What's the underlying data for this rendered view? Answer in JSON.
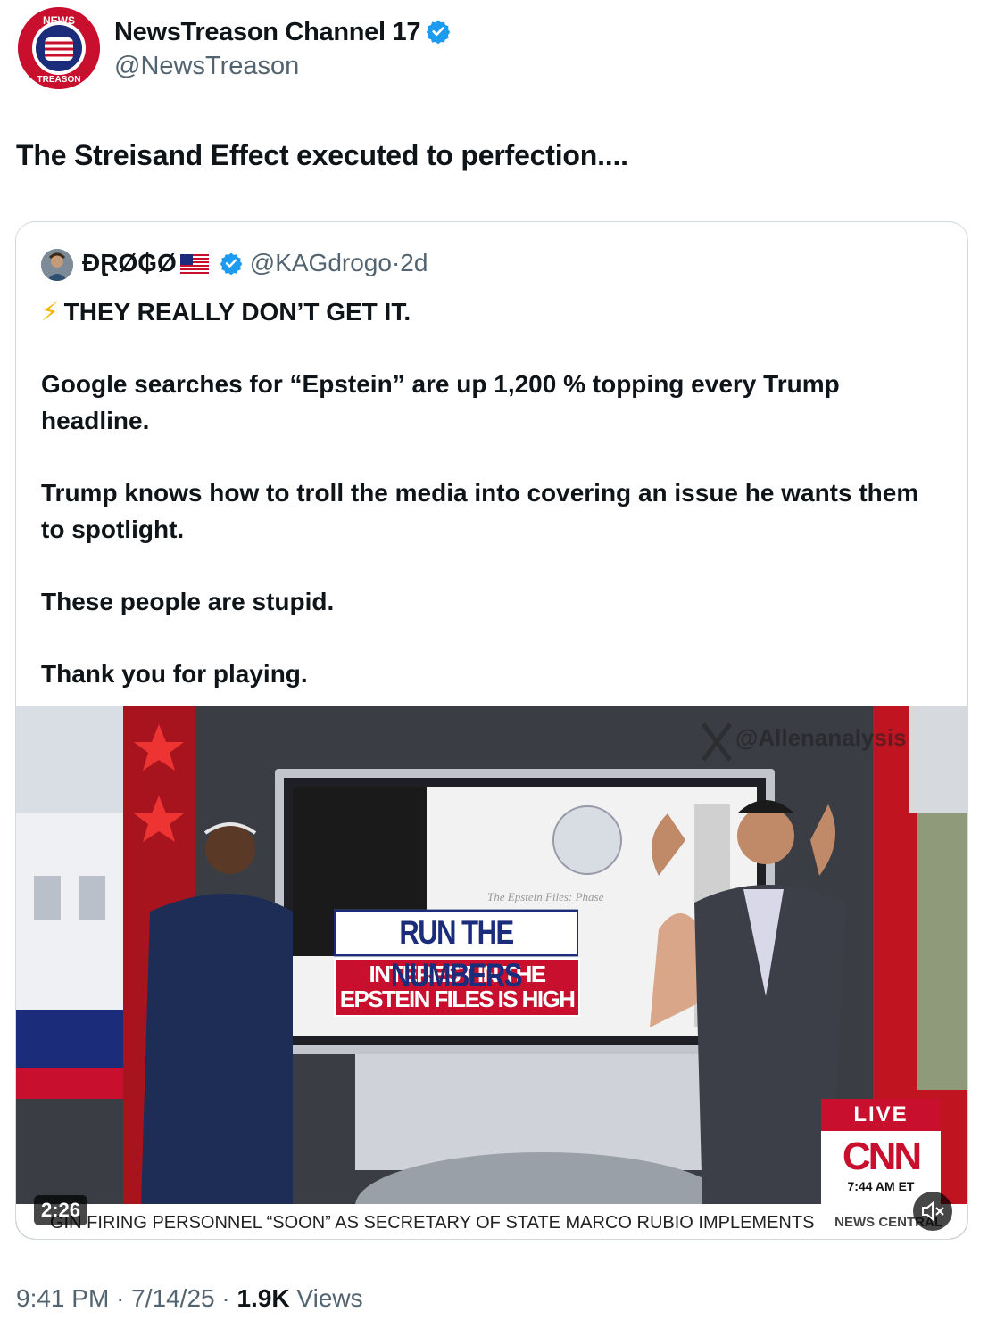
{
  "author": {
    "name": "NewsTreason Channel 17",
    "handle": "@NewsTreason",
    "avatar_text_top": "NEWS",
    "avatar_text_bottom": "TREASON",
    "verified_color": "#1d9bf0"
  },
  "tweet": {
    "text": "The Streisand Effect executed to perfection...."
  },
  "quote": {
    "name": "ĐⱤØ₲Ø",
    "handle": "@KAGdrogo",
    "separator": "·",
    "age": "2d",
    "bolt": "⚡",
    "paragraphs": [
      "THEY REALLY DON’T GET IT.",
      "Google searches for “Epstein” are up 1,200 % topping every Trump headline.",
      "Trump knows how to troll the media into covering an issue he wants them to spotlight.",
      "These people are stupid.",
      "Thank you for playing."
    ]
  },
  "video": {
    "banner_top": "RUN THE NUMBERS",
    "banner_line1": "INTEREST IN THE",
    "banner_line2": "EPSTEIN FILES IS HIGH",
    "screen_doc_text": "The Epstein Files: Phase",
    "watermark": "@Allenanalysis",
    "live_label": "LIVE",
    "network_logo": "CNN",
    "network_time": "7:44 AM ET",
    "ticker": "GIN FIRING PERSONNEL “SOON” AS SECRETARY OF STATE MARCO RUBIO IMPLEMENTS",
    "ticker_tag": "NEWS CENTRAL",
    "duration": "2:26"
  },
  "footer": {
    "time": "9:41 PM",
    "sep1": "·",
    "date": "7/14/25",
    "sep2": "·",
    "views_count": "1.9K",
    "views_label": "Views"
  }
}
